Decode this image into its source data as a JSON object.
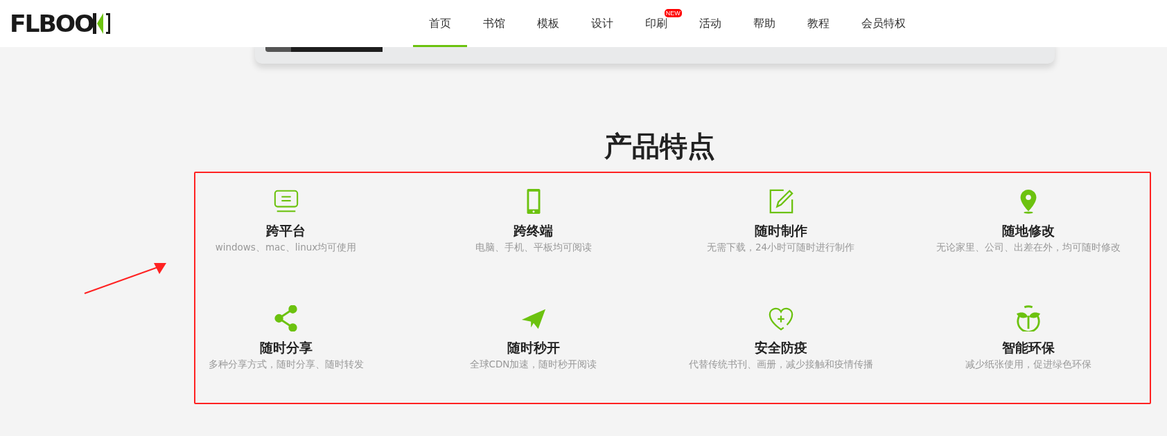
{
  "header": {
    "logo": "FLBOO",
    "nav": [
      {
        "label": "首页",
        "selected": true
      },
      {
        "label": "书馆",
        "selected": false
      },
      {
        "label": "模板",
        "selected": false
      },
      {
        "label": "设计",
        "selected": false
      },
      {
        "label": "印刷",
        "selected": false,
        "badge": "NEW"
      },
      {
        "label": "活动",
        "selected": false
      },
      {
        "label": "帮助",
        "selected": false
      },
      {
        "label": "教程",
        "selected": false
      },
      {
        "label": "会员特权",
        "selected": false
      }
    ]
  },
  "section": {
    "title": "产品特点",
    "features": [
      {
        "kind": "monitor",
        "title": "跨平台",
        "description": "windows、mac、linux均可使用"
      },
      {
        "kind": "phone",
        "title": "跨终端",
        "description": "电脑、手机、平板均可阅读"
      },
      {
        "kind": "edit",
        "title": "随时制作",
        "description": "无需下载，24小时可随时进行制作"
      },
      {
        "kind": "pin",
        "title": "随地修改",
        "description": "无论家里、公司、出差在外，均可随时修改"
      },
      {
        "kind": "share",
        "title": "随时分享",
        "description": "多种分享方式，随时分享、随时转发"
      },
      {
        "kind": "plane",
        "title": "随时秒开",
        "description": "全球CDN加速，随时秒开阅读"
      },
      {
        "kind": "heart",
        "title": "安全防疫",
        "description": "代替传统书刊、画册，减少接触和疫情传播"
      },
      {
        "kind": "sprout",
        "title": "智能环保",
        "description": "减少纸张使用，促进绿色环保"
      }
    ]
  }
}
